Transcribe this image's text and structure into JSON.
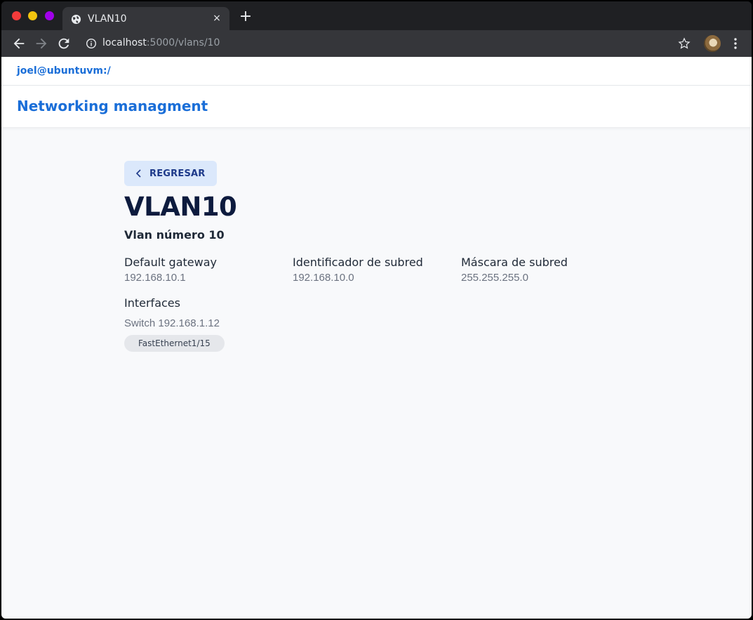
{
  "browser": {
    "tab_title": "VLAN10",
    "tab_close": "×",
    "new_tab": "+",
    "url_host": "localhost",
    "url_rest": ":5000/vlans/10"
  },
  "app": {
    "user": "joel@ubuntuvm:/",
    "brand": "Networking managment"
  },
  "vlan": {
    "back_label": "REGRESAR",
    "title": "VLAN10",
    "subtitle": "Vlan número 10",
    "fields": [
      {
        "label": "Default gateway",
        "value": "192.168.10.1"
      },
      {
        "label": "Identificador de subred",
        "value": "192.168.10.0"
      },
      {
        "label": "Máscara de subred",
        "value": "255.255.255.0"
      }
    ],
    "interfaces_title": "Interfaces",
    "switch_label": "Switch 192.168.1.12",
    "interfaces": [
      "FastEthernet1/15"
    ]
  },
  "colors": {
    "brand": "#1a6ed8",
    "title": "#0d1b3e",
    "back_bg": "#dbe8fb"
  }
}
